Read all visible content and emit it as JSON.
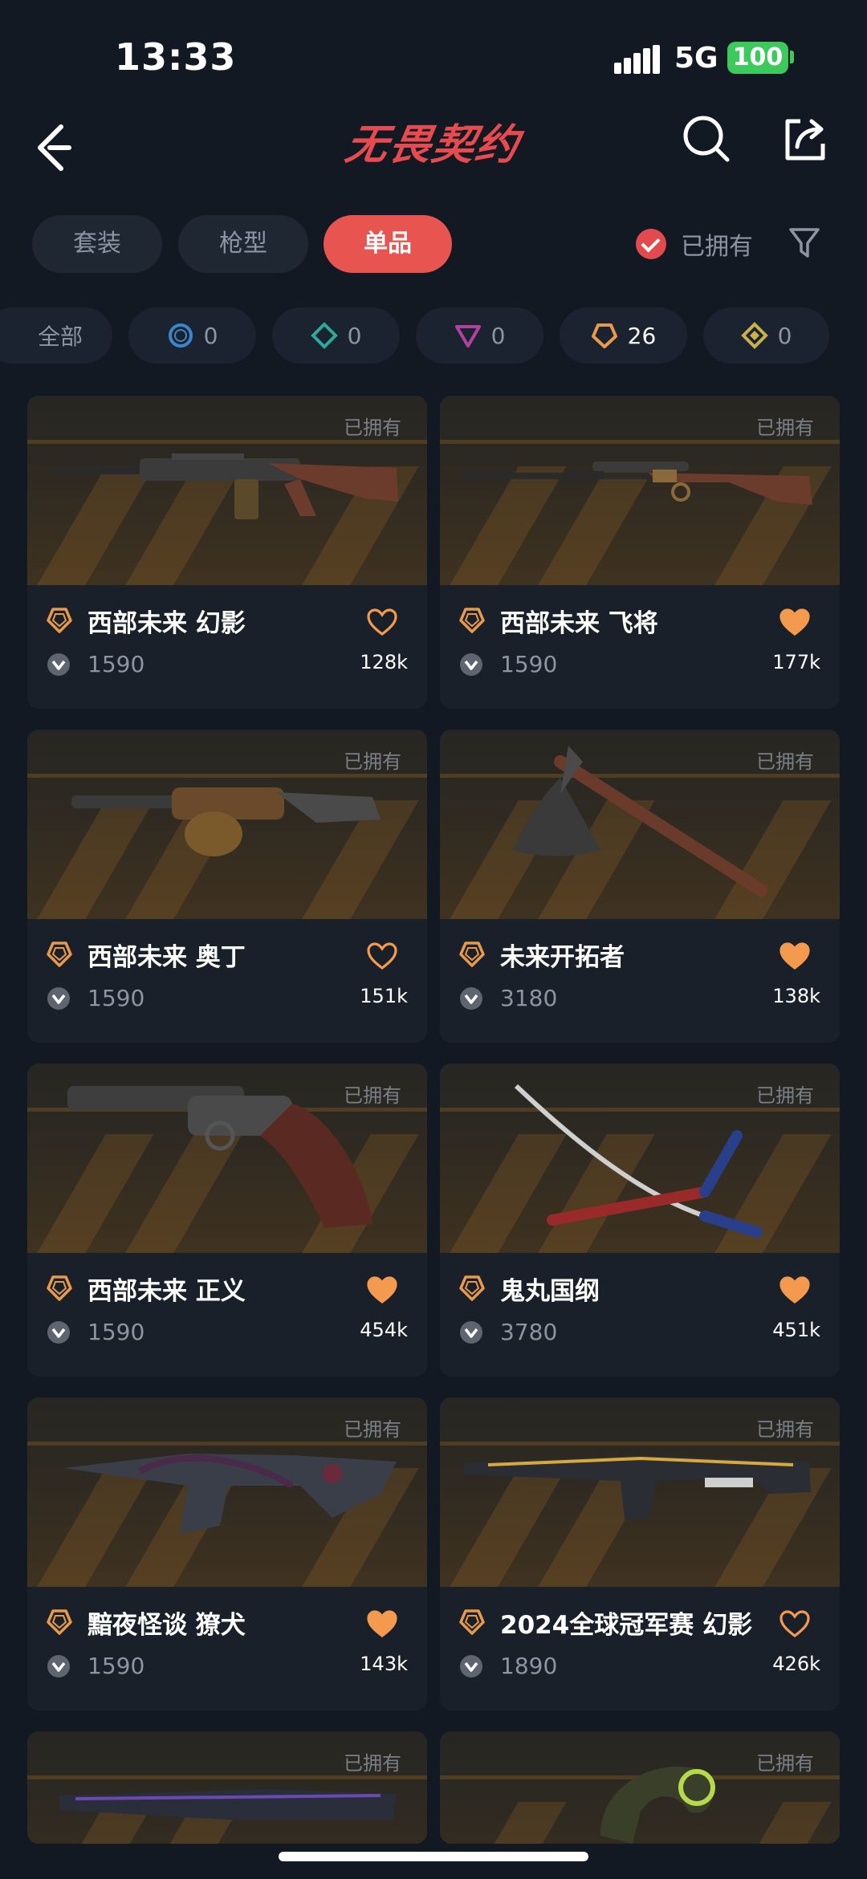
{
  "status": {
    "time": "13:33",
    "network": "5G",
    "battery": "100"
  },
  "nav": {
    "title": "无畏契约"
  },
  "tabs": [
    {
      "label": "套装",
      "active": false
    },
    {
      "label": "枪型",
      "active": false
    },
    {
      "label": "单品",
      "active": true
    }
  ],
  "filter": {
    "owned_label": "已拥有",
    "owned_checked": true
  },
  "tiers": [
    {
      "label": "全部"
    },
    {
      "icon": "select-tier-icon",
      "color": "#3a86c8",
      "count": "0"
    },
    {
      "icon": "deluxe-tier-icon",
      "color": "#2fa89a",
      "count": "0"
    },
    {
      "icon": "premium-tier-icon",
      "color": "#b0429e",
      "count": "0"
    },
    {
      "icon": "exclusive-tier-icon",
      "color": "#e89a4a",
      "count": "26"
    },
    {
      "icon": "ultra-tier-icon",
      "color": "#c9b248",
      "count": "0"
    }
  ],
  "colors": {
    "accent": "#e85450",
    "heart": "#f49a4e",
    "tier_exclusive": "#e89a4a"
  },
  "cards": [
    {
      "owned": "已拥有",
      "name": "西部未来 幻影",
      "price": "1590",
      "likes": "128k",
      "liked": false,
      "weapon_icon": "rifle-icon"
    },
    {
      "owned": "已拥有",
      "name": "西部未来 飞将",
      "price": "1590",
      "likes": "177k",
      "liked": true,
      "weapon_icon": "sniper-icon"
    },
    {
      "owned": "已拥有",
      "name": "西部未来 奥丁",
      "price": "1590",
      "likes": "151k",
      "liked": false,
      "weapon_icon": "heavy-gun-icon"
    },
    {
      "owned": "已拥有",
      "name": "未来开拓者",
      "price": "3180",
      "likes": "138k",
      "liked": true,
      "weapon_icon": "axe-icon"
    },
    {
      "owned": "已拥有",
      "name": "西部未来 正义",
      "price": "1590",
      "likes": "454k",
      "liked": true,
      "weapon_icon": "revolver-icon"
    },
    {
      "owned": "已拥有",
      "name": "鬼丸国纲",
      "price": "3780",
      "likes": "451k",
      "liked": true,
      "weapon_icon": "katana-icon"
    },
    {
      "owned": "已拥有",
      "name": "黯夜怪谈 獠犬",
      "price": "1590",
      "likes": "143k",
      "liked": true,
      "weapon_icon": "smg-icon"
    },
    {
      "owned": "已拥有",
      "name": "2024全球冠军赛 幻影",
      "price": "1890",
      "likes": "426k",
      "liked": false,
      "weapon_icon": "rifle-icon"
    },
    {
      "owned": "已拥有",
      "name": "",
      "price": "",
      "likes": "",
      "liked": false,
      "weapon_icon": "rifle-icon"
    },
    {
      "owned": "已拥有",
      "name": "",
      "price": "",
      "likes": "",
      "liked": false,
      "weapon_icon": "karambit-icon"
    }
  ]
}
